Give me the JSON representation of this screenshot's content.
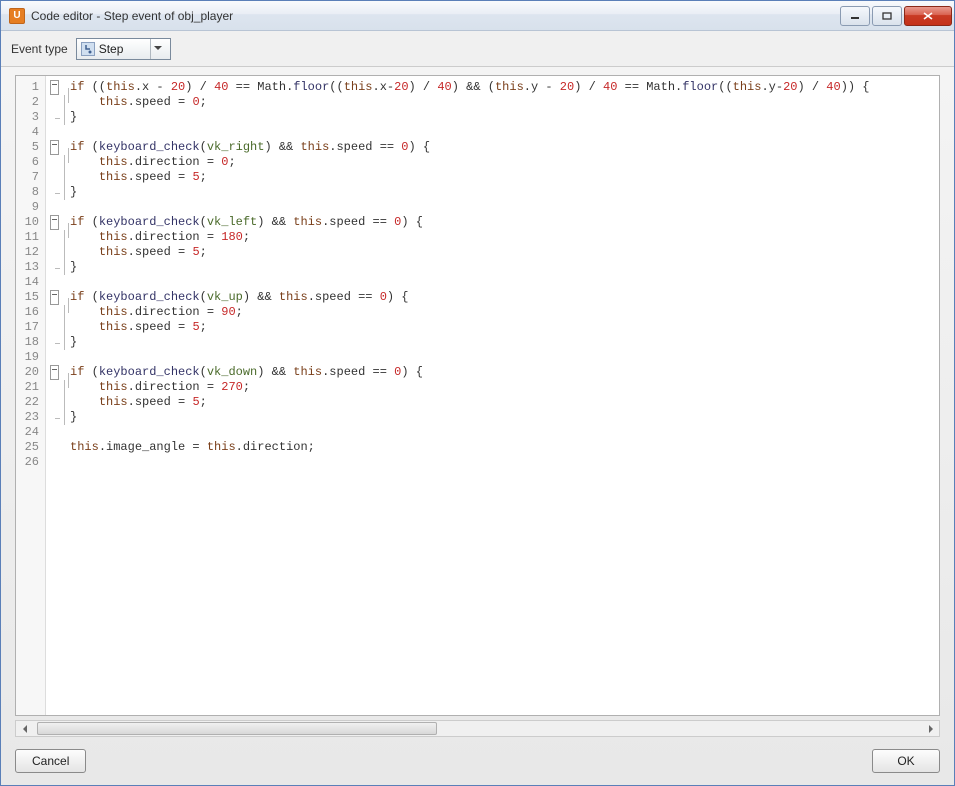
{
  "window": {
    "title": "Code editor - Step event of obj_player"
  },
  "toolbar": {
    "event_type_label": "Event type",
    "dropdown_value": "Step"
  },
  "buttons": {
    "cancel": "Cancel",
    "ok": "OK"
  },
  "code_lines": [
    {
      "n": 1,
      "fold": "start",
      "html": "<span class='kw'>if</span> ((<span class='kw'>this</span>.x - <span class='num'>20</span>) / <span class='num'>40</span> == Math.<span class='fn'>floor</span>((<span class='kw'>this</span>.x-<span class='num'>20</span>) / <span class='num'>40</span>) &amp;&amp; (<span class='kw'>this</span>.y - <span class='num'>20</span>) / <span class='num'>40</span> == Math.<span class='fn'>floor</span>((<span class='kw'>this</span>.y-<span class='num'>20</span>) / <span class='num'>40</span>)) {"
    },
    {
      "n": 2,
      "fold": "mid",
      "html": "    <span class='kw'>this</span>.speed = <span class='num'>0</span>;"
    },
    {
      "n": 3,
      "fold": "end",
      "html": "}"
    },
    {
      "n": 4,
      "fold": "none",
      "html": ""
    },
    {
      "n": 5,
      "fold": "start",
      "html": "<span class='kw'>if</span> (<span class='fn'>keyboard_check</span>(<span class='id'>vk_right</span>) &amp;&amp; <span class='kw'>this</span>.speed == <span class='num'>0</span>) {"
    },
    {
      "n": 6,
      "fold": "mid",
      "html": "    <span class='kw'>this</span>.direction = <span class='num'>0</span>;"
    },
    {
      "n": 7,
      "fold": "mid",
      "html": "    <span class='kw'>this</span>.speed = <span class='num'>5</span>;"
    },
    {
      "n": 8,
      "fold": "end",
      "html": "}"
    },
    {
      "n": 9,
      "fold": "none",
      "html": ""
    },
    {
      "n": 10,
      "fold": "start",
      "html": "<span class='kw'>if</span> (<span class='fn'>keyboard_check</span>(<span class='id'>vk_left</span>) &amp;&amp; <span class='kw'>this</span>.speed == <span class='num'>0</span>) {"
    },
    {
      "n": 11,
      "fold": "mid",
      "html": "    <span class='kw'>this</span>.direction = <span class='num'>180</span>;"
    },
    {
      "n": 12,
      "fold": "mid",
      "html": "    <span class='kw'>this</span>.speed = <span class='num'>5</span>;"
    },
    {
      "n": 13,
      "fold": "end",
      "html": "}"
    },
    {
      "n": 14,
      "fold": "none",
      "html": ""
    },
    {
      "n": 15,
      "fold": "start",
      "html": "<span class='kw'>if</span> (<span class='fn'>keyboard_check</span>(<span class='id'>vk_up</span>) &amp;&amp; <span class='kw'>this</span>.speed == <span class='num'>0</span>) {"
    },
    {
      "n": 16,
      "fold": "mid",
      "html": "    <span class='kw'>this</span>.direction = <span class='num'>90</span>;"
    },
    {
      "n": 17,
      "fold": "mid",
      "html": "    <span class='kw'>this</span>.speed = <span class='num'>5</span>;"
    },
    {
      "n": 18,
      "fold": "end",
      "html": "}"
    },
    {
      "n": 19,
      "fold": "none",
      "html": ""
    },
    {
      "n": 20,
      "fold": "start",
      "html": "<span class='kw'>if</span> (<span class='fn'>keyboard_check</span>(<span class='id'>vk_down</span>) &amp;&amp; <span class='kw'>this</span>.speed == <span class='num'>0</span>) {"
    },
    {
      "n": 21,
      "fold": "mid",
      "html": "    <span class='kw'>this</span>.direction = <span class='num'>270</span>;"
    },
    {
      "n": 22,
      "fold": "mid",
      "html": "    <span class='kw'>this</span>.speed = <span class='num'>5</span>;"
    },
    {
      "n": 23,
      "fold": "end",
      "html": "}"
    },
    {
      "n": 24,
      "fold": "none",
      "html": ""
    },
    {
      "n": 25,
      "fold": "none",
      "html": "<span class='kw'>this</span>.image_angle = <span class='kw'>this</span>.direction;"
    },
    {
      "n": 26,
      "fold": "none",
      "html": ""
    }
  ]
}
